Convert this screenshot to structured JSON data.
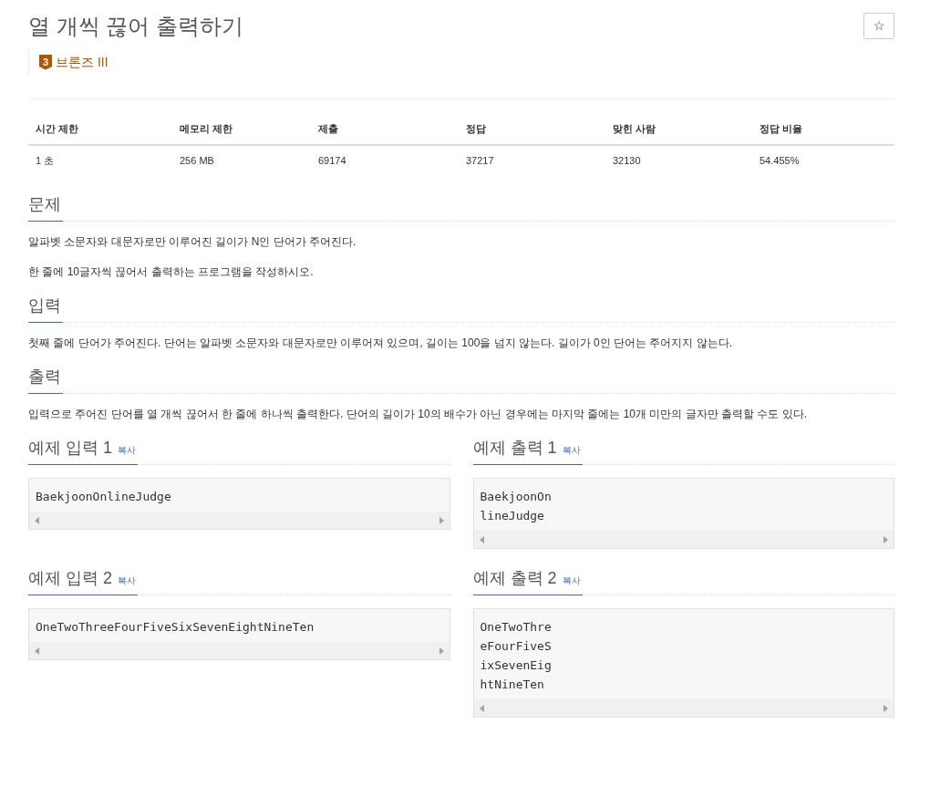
{
  "title": "열 개씩 끊어 출력하기",
  "star_button": "☆",
  "tier": {
    "level": "3",
    "label": "브론즈 III"
  },
  "stats": {
    "columns": [
      "시간 제한",
      "메모리 제한",
      "제출",
      "정답",
      "맞힌 사람",
      "정답 비율"
    ],
    "values": [
      "1 초",
      "256 MB",
      "69174",
      "37217",
      "32130",
      "54.455%"
    ]
  },
  "sections": [
    {
      "heading": "문제",
      "paragraphs": [
        "알파벳 소문자와 대문자로만 이루어진 길이가 N인 단어가 주어진다.",
        "한 줄에 10글자씩 끊어서 출력하는 프로그램을 작성하시오."
      ]
    },
    {
      "heading": "입력",
      "paragraphs": [
        "첫째 줄에 단어가 주어진다. 단어는 알파벳 소문자와 대문자로만 이루어져 있으며, 길이는 100을 넘지 않는다. 길이가 0인 단어는 주어지지 않는다."
      ]
    },
    {
      "heading": "출력",
      "paragraphs": [
        "입력으로 주어진 단어를 열 개씩 끊어서 한 줄에 하나씩 출력한다. 단어의 길이가 10의 배수가 아닌 경우에는 마지막 줄에는 10개 미만의 글자만 출력할 수도 있다."
      ]
    }
  ],
  "samples": [
    {
      "heading": "예제 입력 1",
      "copy": "복사",
      "lines": [
        "BaekjoonOnlineJudge"
      ]
    },
    {
      "heading": "예제 출력 1",
      "copy": "복사",
      "lines": [
        "BaekjoonOn",
        "lineJudge"
      ]
    },
    {
      "heading": "예제 입력 2",
      "copy": "복사",
      "lines": [
        "OneTwoThreeFourFiveSixSevenEightNineTen"
      ]
    },
    {
      "heading": "예제 출력 2",
      "copy": "복사",
      "lines": [
        "OneTwoThre",
        "eFourFiveS",
        "ixSevenEig",
        "htNineTen"
      ]
    }
  ]
}
